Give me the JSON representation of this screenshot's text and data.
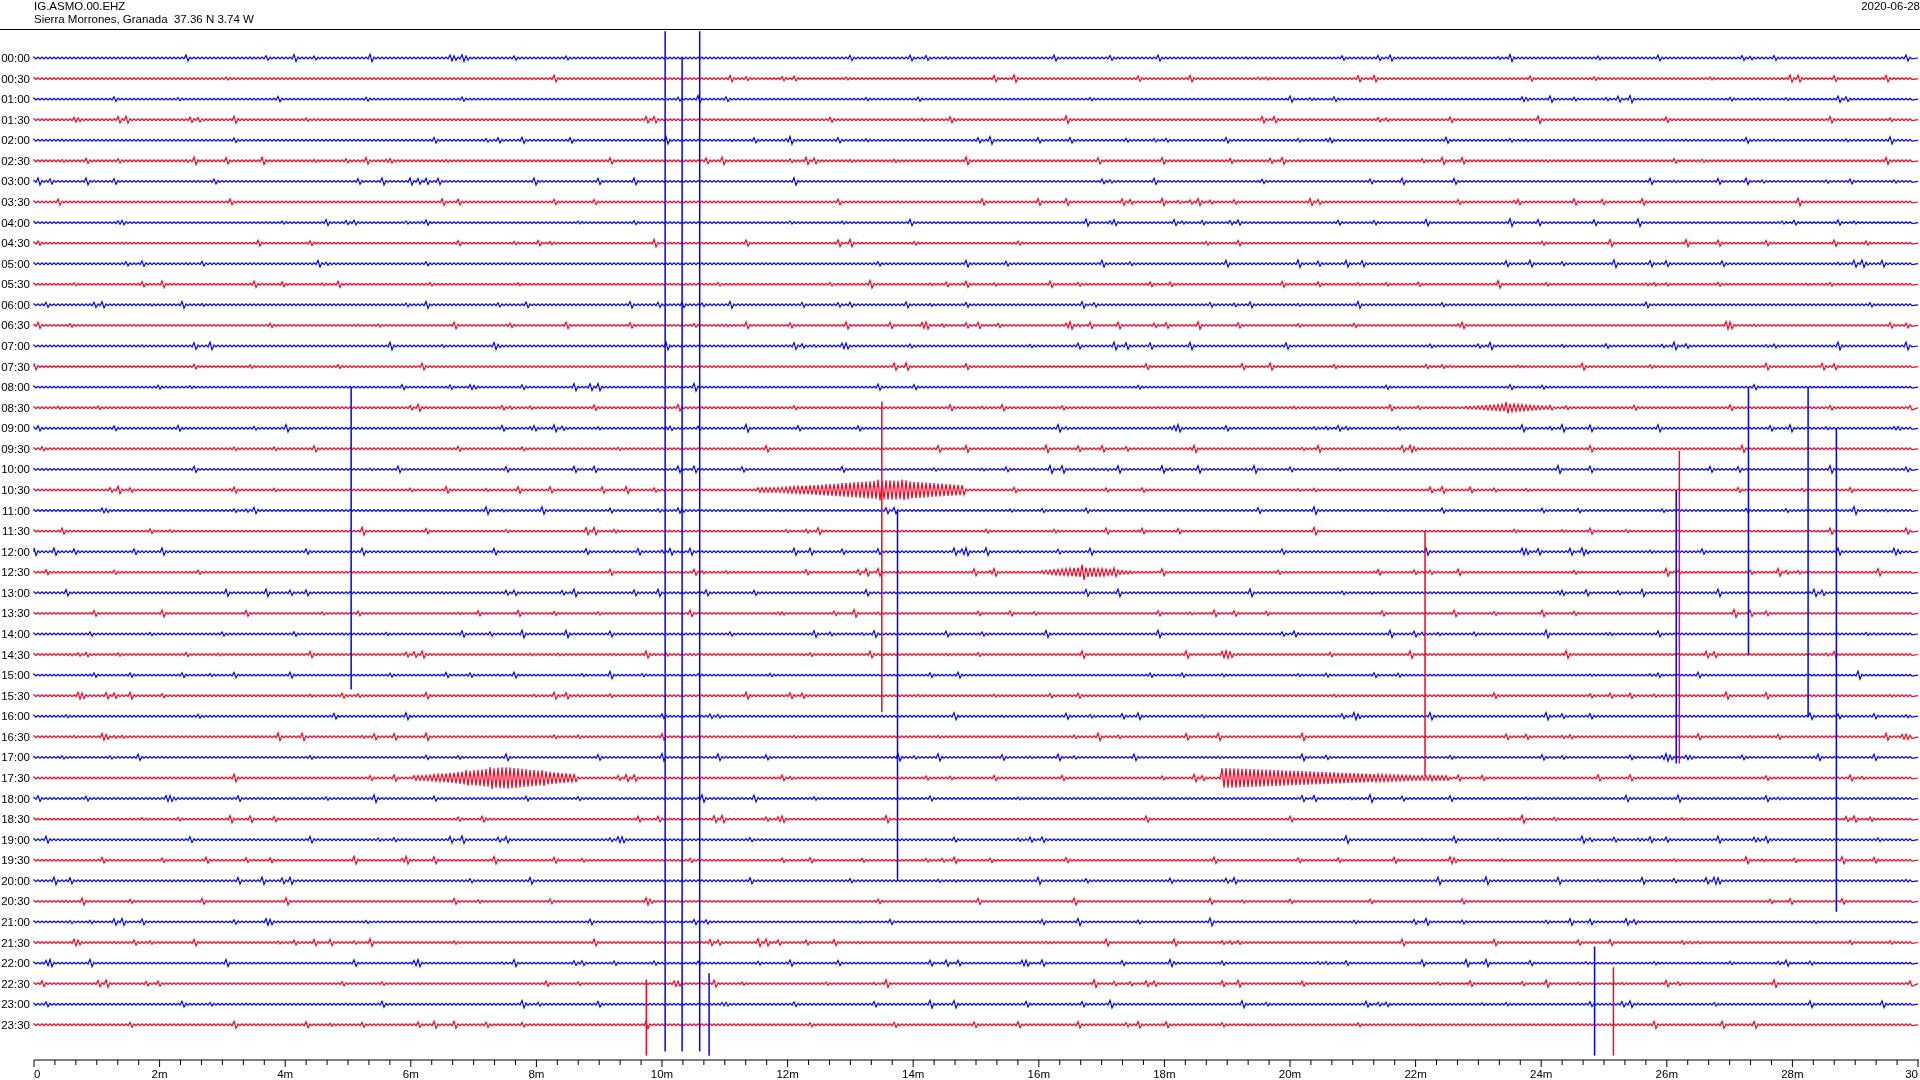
{
  "header": {
    "station": "IG.ASMO.00.EHZ",
    "location": "Sierra Morrones, Granada  37.36 N 3.74 W",
    "date": "2020-06-28"
  },
  "rows": [
    {
      "label": "00:00",
      "color": "#0000ff"
    },
    {
      "label": "00:30",
      "color": "#ff0020"
    },
    {
      "label": "01:00",
      "color": "#0000ff"
    },
    {
      "label": "01:30",
      "color": "#ff0020"
    },
    {
      "label": "02:00",
      "color": "#0000ff"
    },
    {
      "label": "02:30",
      "color": "#ff0020"
    },
    {
      "label": "03:00",
      "color": "#0000ff"
    },
    {
      "label": "03:30",
      "color": "#ff0020"
    },
    {
      "label": "04:00",
      "color": "#0000ff"
    },
    {
      "label": "04:30",
      "color": "#ff0020"
    },
    {
      "label": "05:00",
      "color": "#0000ff"
    },
    {
      "label": "05:30",
      "color": "#ff0020"
    },
    {
      "label": "06:00",
      "color": "#0000ff"
    },
    {
      "label": "06:30",
      "color": "#ff0020"
    },
    {
      "label": "07:00",
      "color": "#0000ff"
    },
    {
      "label": "07:30",
      "color": "#ff0020"
    },
    {
      "label": "08:00",
      "color": "#0000ff"
    },
    {
      "label": "08:30",
      "color": "#ff0020"
    },
    {
      "label": "09:00",
      "color": "#0000ff"
    },
    {
      "label": "09:30",
      "color": "#ff0020"
    },
    {
      "label": "10:00",
      "color": "#0000ff"
    },
    {
      "label": "10:30",
      "color": "#ff0020"
    },
    {
      "label": "11:00",
      "color": "#0000ff"
    },
    {
      "label": "11:30",
      "color": "#ff0020"
    },
    {
      "label": "12:00",
      "color": "#0000ff"
    },
    {
      "label": "12:30",
      "color": "#ff0020"
    },
    {
      "label": "13:00",
      "color": "#0000ff"
    },
    {
      "label": "13:30",
      "color": "#ff0020"
    },
    {
      "label": "14:00",
      "color": "#0000ff"
    },
    {
      "label": "14:30",
      "color": "#ff0020"
    },
    {
      "label": "15:00",
      "color": "#0000ff"
    },
    {
      "label": "15:30",
      "color": "#ff0020"
    },
    {
      "label": "16:00",
      "color": "#0000ff"
    },
    {
      "label": "16:30",
      "color": "#ff0020"
    },
    {
      "label": "17:00",
      "color": "#0000ff"
    },
    {
      "label": "17:30",
      "color": "#ff0020"
    },
    {
      "label": "18:00",
      "color": "#0000ff"
    },
    {
      "label": "18:30",
      "color": "#ff0020"
    },
    {
      "label": "19:00",
      "color": "#0000ff"
    },
    {
      "label": "19:30",
      "color": "#ff0020"
    },
    {
      "label": "20:00",
      "color": "#0000ff"
    },
    {
      "label": "20:30",
      "color": "#ff0020"
    },
    {
      "label": "21:00",
      "color": "#0000ff"
    },
    {
      "label": "21:30",
      "color": "#ff0020"
    },
    {
      "label": "22:00",
      "color": "#0000ff"
    },
    {
      "label": "22:30",
      "color": "#ff0020"
    },
    {
      "label": "23:00",
      "color": "#0000ff"
    },
    {
      "label": "23:30",
      "color": "#ff0020"
    }
  ],
  "x_axis": {
    "labels": [
      "0",
      "2m",
      "4m",
      "6m",
      "8m",
      "10m",
      "12m",
      "14m",
      "16m",
      "18m",
      "20m",
      "22m",
      "24m",
      "26m",
      "28m",
      "30"
    ]
  }
}
